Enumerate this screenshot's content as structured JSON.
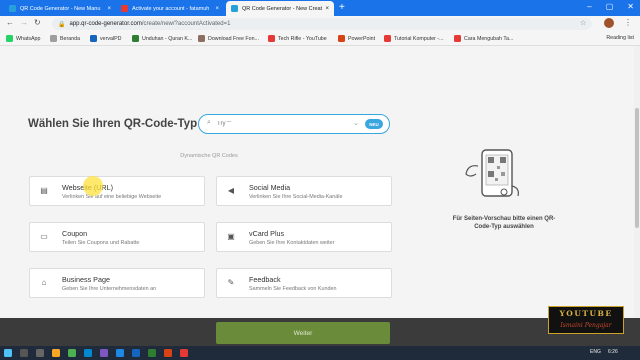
{
  "browser": {
    "tabs": [
      {
        "label": "QR Code Generator - New Manu",
        "color": "#26a0da",
        "active": false
      },
      {
        "label": "Activate your account - fatamuh",
        "color": "#e53935",
        "active": false
      },
      {
        "label": "QR Code Generator - New Creat",
        "color": "#26a0da",
        "active": true
      }
    ],
    "new_tab_label": "+",
    "url_host": "app.qr-code-generator.com",
    "url_path": "/create/new/?accountActivated=1",
    "bookmarks": [
      {
        "label": "WhatsApp",
        "color": "#25d366"
      },
      {
        "label": "Beranda",
        "color": "#9e9e9e"
      },
      {
        "label": "vervalPD",
        "color": "#1565c0"
      },
      {
        "label": "Unduhan - Quran K...",
        "color": "#2e7d32"
      },
      {
        "label": "Download Free Fon...",
        "color": "#8d6e63"
      },
      {
        "label": "Tech Rifle - YouTube",
        "color": "#e53935"
      },
      {
        "label": "PowerPoint",
        "color": "#d84315"
      },
      {
        "label": "Tutorial Komputer -...",
        "color": "#e53935"
      },
      {
        "label": "Cara Mengubah Ta...",
        "color": "#e53935"
      }
    ],
    "reading_list": "Reading list"
  },
  "page": {
    "headline": "Wählen Sie Ihren QR-Code-Typ",
    "search_placeholder": "Try \"\"",
    "new_badge": "NEU",
    "section_label": "Dynamische QR Codes",
    "cards": [
      {
        "title": "Webseite (URL)",
        "desc": "Verlinken Sie auf eine beliebige Webseite",
        "icon": "browser-window-icon"
      },
      {
        "title": "Social Media",
        "desc": "Verlinken Sie Ihre Social-Media-Kanäle",
        "icon": "megaphone-icon"
      },
      {
        "title": "Coupon",
        "desc": "Teilen Sie Coupons und Rabatte",
        "icon": "ticket-icon"
      },
      {
        "title": "vCard Plus",
        "desc": "Geben Sie Ihre Kontaktdaten weiter",
        "icon": "contact-card-icon"
      },
      {
        "title": "Business Page",
        "desc": "Geben Sie Ihre Unternehmensdaten an",
        "icon": "storefront-icon"
      },
      {
        "title": "Feedback",
        "desc": "Sammeln Sie Feedback von Kunden",
        "icon": "chat-icon"
      }
    ],
    "preview_text": "Für Seiten-Vorschau bitte einen QR-Code-Typ auswählen",
    "next_button": "Weiter"
  },
  "overlay": {
    "line1": "YOUTUBE",
    "line2": "Ismaini Pengajar"
  },
  "taskbar": {
    "lang": "ENG",
    "time": "6:26",
    "accent": "#1f2a3a"
  }
}
